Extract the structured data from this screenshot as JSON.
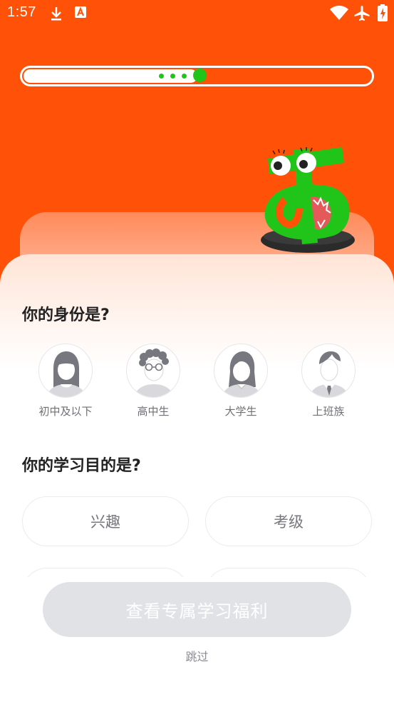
{
  "status_bar": {
    "time": "1:57",
    "icons": [
      "download-icon",
      "app-notification-icon",
      "wifi-icon",
      "airplane-mode-icon",
      "battery-charging-icon"
    ]
  },
  "progress": {
    "value": 0.5,
    "pending_dots": 3
  },
  "mascot": {
    "glyph": "あ",
    "color": "#21c51a",
    "name": "hiragana-a-mascot"
  },
  "identity_section": {
    "title": "你的身份是?",
    "options": [
      {
        "label": "初中及以下",
        "avatar": "girl-long-hair-avatar"
      },
      {
        "label": "高中生",
        "avatar": "boy-curly-hair-glasses-avatar"
      },
      {
        "label": "大学生",
        "avatar": "young-woman-avatar"
      },
      {
        "label": "上班族",
        "avatar": "office-man-tie-avatar"
      }
    ]
  },
  "goal_section": {
    "title": "你的学习目的是?",
    "options": [
      {
        "label": "兴趣"
      },
      {
        "label": "考级"
      }
    ]
  },
  "cta_label": "查看专属学习福利",
  "skip_label": "跳过",
  "colors": {
    "brand_orange": "#ff5108",
    "accent_green": "#21c51a",
    "cta_disabled": "#e1e2e6"
  }
}
